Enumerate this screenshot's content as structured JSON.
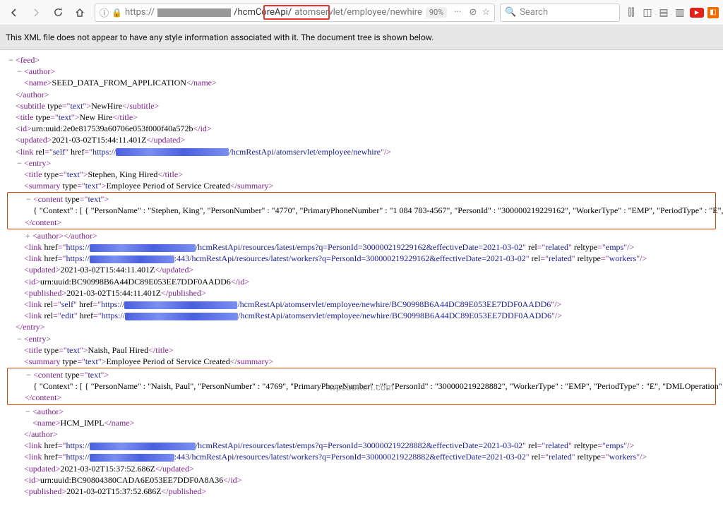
{
  "toolbar": {
    "zoom": "90%",
    "search_ph": "Search"
  },
  "url": {
    "proto": "https://",
    "dom_blur_w": 104,
    "seg1": "/hcmCoreApi/",
    "seg2": "atomservlet/employee/newhire"
  },
  "infobar": "This XML file does not appear to have any style information associated with it. The document tree is shown below.",
  "feed": {
    "author_name": "SEED_DATA_FROM_APPLICATION",
    "subtitle": "NewHire",
    "title": "New Hire",
    "id": "urn:uuid:2e0e817539a60706e053f000f40a572b",
    "updated": "2021-03-02T15:44:11.401Z",
    "selflink": "/hcmRestApi/atomservlet/employee/newhire"
  },
  "entry1": {
    "title": "Stephen, King Hired",
    "summary": "Employee Period of Service Created",
    "content": "{ \"Context\" : [ { \"PersonName\" : \"Stephen, King\", \"PersonNumber\" : \"4770\", \"PrimaryPhoneNumber\" : \"1 084 783-4567\", \"PersonId\" : \"300000219229162\", \"WorkerType\" : \"EMP\", \"PeriodType\" : \"E\", \"DMLOperation\" : \"INSERT\", \"EffectiveStartDate\" : \"2021-03-02\", \"EffectiveDate\" : \"2021-03-02\" } ] }",
    "link1": "/hcmRestApi/resources/latest/emps?q=PersonId=300000219229162&effectiveDate=2021-03-02",
    "link1_rel": "related",
    "link1_rt": "emps",
    "link2_pre": ":443/hcmRestApi/resources/latest/workers?q=PersonId=300000219229162&effectiveDate=2021-03-02",
    "link2_rel": "related",
    "link2_rt": "workers",
    "updated": "2021-03-02T15:44:11.401Z",
    "id": "urn:uuid:BC90998B6A44DC89E053EE7DDF0AADD6",
    "published": "2021-03-02T15:44:11.401Z",
    "selflink": "/hcmRestApi/atomservlet/employee/newhire/BC90998B6A44DC89E053EE7DDF0AADD6",
    "editlink": "/hcmRestApi/atomservlet/employee/newhire/BC90998B6A44DC89E053EE7DDF0AADD6"
  },
  "entry2": {
    "title": "Naish, Paul Hired",
    "summary": "Employee Period of Service Created",
    "content": "{ \"Context\" : [ { \"PersonName\" : \"Naish, Paul\", \"PersonNumber\" : \"4769\", \"PrimaryPhoneNumber\" : \"\", \"PersonId\" : \"300000219228882\", \"WorkerType\" : \"EMP\", \"PeriodType\" : \"E\", \"DMLOperation\" : \"INSERT\", \"EffectiveStartDate\" : \"2021-03-02\", \"EffectiveDate\" : \"2021-03-02\" } ] }",
    "author": "HCM_IMPL",
    "link1": "/hcmRestApi/resources/latest/emps?q=PersonId=300000219228882&effectiveDate=2021-03-02",
    "link1_rel": "related",
    "link1_rt": "emps",
    "link2_pre": ":443/hcmRestApi/resources/latest/workers?q=PersonId=300000219228882&effectiveDate=2021-03-02",
    "link2_rel": "related",
    "link2_rt": "workers",
    "updated": "2021-03-02T15:37:52.686Z",
    "id": "urn:uuid:BC90804380CADA6E053EE7DDF0A8A36",
    "published": "2021-03-02T15:37:52.686Z"
  },
  "watermark": "wpsbutton.com"
}
